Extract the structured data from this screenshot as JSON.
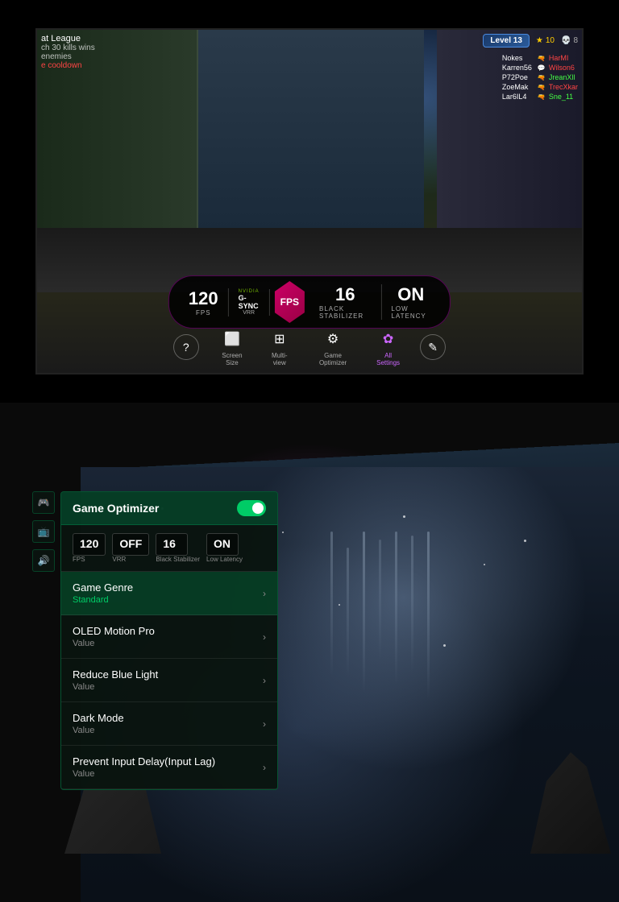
{
  "top": {
    "hud": {
      "match_type": "at League",
      "kill_target": "ch 30 kills wins",
      "enemies_label": "enemies",
      "cooldown_label": "e cooldown"
    },
    "level_badge": "Level 13",
    "star_count": "10",
    "skull_count": "8",
    "players": [
      {
        "name": "Nokes",
        "icon": "🔫",
        "score": "HarMI",
        "score_color": "red"
      },
      {
        "name": "Karren56",
        "icon": "💬",
        "score": "Wilson6",
        "score_color": "red"
      },
      {
        "name": "P72Poe",
        "icon": "🔫",
        "score": "JreanXll",
        "score_color": "green"
      },
      {
        "name": "ZoeMak",
        "icon": "🔫",
        "score": "TrecXkar",
        "score_color": "red"
      },
      {
        "name": "Lar6IL4",
        "icon": "🔫",
        "score": "Sne_11",
        "score_color": "green"
      }
    ],
    "score_panel": {
      "fps_value": "120",
      "fps_label": "FPS",
      "gsync_nvidia": "NVIDIA",
      "gsync_text": "G-SYNC",
      "gsync_vrr": "VRR",
      "center_label": "FPS",
      "black_stab_value": "16",
      "black_stab_label": "Black Stabilizer",
      "low_latency_value": "ON",
      "low_latency_label": "Low Latency"
    },
    "toolbar": {
      "help_label": "",
      "screen_size_label": "Screen Size",
      "multi_view_label": "Multi-view",
      "game_optimizer_label": "Game Optimizer",
      "all_settings_label": "All Settings"
    }
  },
  "bottom": {
    "optimizer": {
      "title": "Game Optimizer",
      "toggle_state": "on",
      "stats": {
        "fps": {
          "value": "120",
          "label": "FPS"
        },
        "vrr": {
          "value": "OFF",
          "label": "VRR"
        },
        "black_stab": {
          "value": "16",
          "label": "Black Stabilizer"
        },
        "low_latency": {
          "value": "ON",
          "label": "Low Latency"
        }
      },
      "menu_items": [
        {
          "name": "Game Genre",
          "value": "Standard",
          "value_color": "green",
          "active": true
        },
        {
          "name": "OLED Motion Pro",
          "value": "Value",
          "value_color": "grey"
        },
        {
          "name": "Reduce Blue Light",
          "value": "Value",
          "value_color": "grey"
        },
        {
          "name": "Dark Mode",
          "value": "Value",
          "value_color": "grey"
        },
        {
          "name": "Prevent Input Delay(Input Lag)",
          "value": "Value",
          "value_color": "grey"
        }
      ]
    },
    "sidebar_icons": [
      "🎮",
      "📺",
      "🔊"
    ]
  }
}
